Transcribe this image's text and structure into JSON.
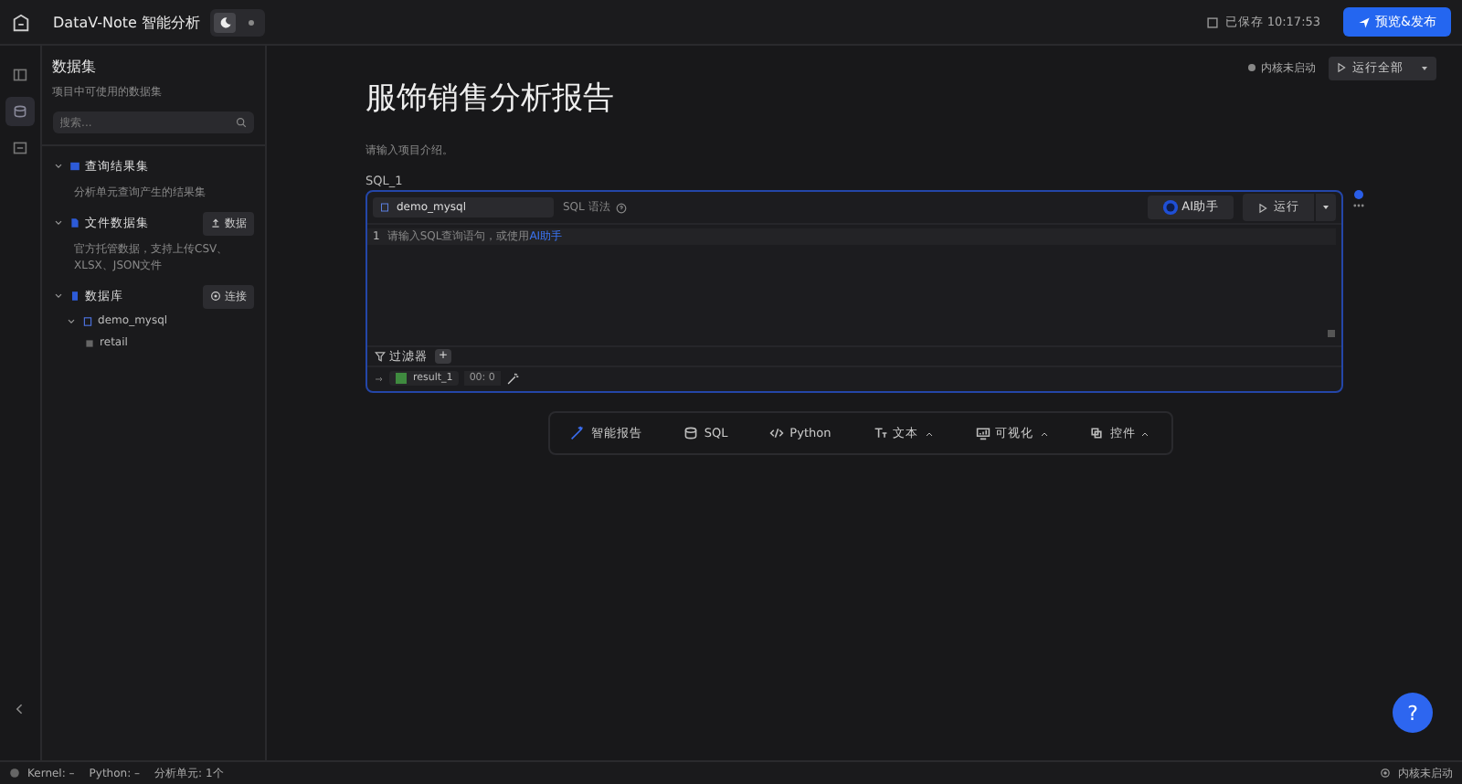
{
  "header": {
    "app_title": "DataV-Note 智能分析",
    "theme_modes": [
      {
        "kind": "dark",
        "selected": true
      },
      {
        "kind": "light",
        "selected": false
      }
    ],
    "saved": "已保存 10:17:53",
    "publish": "预览&发布"
  },
  "rail": [
    {
      "kind": "layout",
      "selected": false
    },
    {
      "kind": "database",
      "selected": true
    },
    {
      "kind": "code",
      "selected": false
    }
  ],
  "sidebar": {
    "title": "数据集",
    "subtitle": "项目中可使用的数据集",
    "search": {
      "placeholder": "搜索..."
    },
    "sections": [
      {
        "kind": "result",
        "label": "查询结果集",
        "expanded": true,
        "description": "分析单元查询产生的结果集"
      },
      {
        "kind": "file",
        "label": "文件数据集",
        "expanded": true,
        "action": "数据",
        "description": "官方托管数据，支持上传CSV、XLSX、JSON文件"
      },
      {
        "kind": "database",
        "label": "数据库",
        "expanded": true,
        "action": "连接",
        "children": [
          {
            "label": "demo_mysql",
            "expanded": true,
            "children": [
              {
                "label": "retail"
              }
            ]
          }
        ]
      }
    ]
  },
  "main": {
    "kernel_status": "内核未启动",
    "run_all": "运行全部",
    "title": "服饰销售分析报告",
    "description": {
      "placeholder": "请输入项目介绍。"
    },
    "cell": {
      "name": "SQL_1",
      "datasource": "demo_mysql",
      "syntax": "SQL 语法",
      "ai_button": "AI助手",
      "run_button": "运行",
      "line_number": "1",
      "editor_placeholder": "请输入SQL查询语句，或使用",
      "ai_link": "AI助手",
      "filter": "过滤器",
      "filter_add": "+",
      "result": "result_1",
      "count": "00: 0"
    },
    "add_bar": [
      {
        "kind": "ai",
        "label": "智能报告",
        "has_menu": false
      },
      {
        "kind": "sql",
        "label": "SQL",
        "has_menu": false
      },
      {
        "kind": "python",
        "label": "Python",
        "has_menu": false
      },
      {
        "kind": "text",
        "label": "文本",
        "has_menu": true
      },
      {
        "kind": "chart",
        "label": "可视化",
        "has_menu": true
      },
      {
        "kind": "widget",
        "label": "控件",
        "has_menu": true
      }
    ]
  },
  "help_button": "?",
  "status_bar": {
    "kernel": "Kernel: –",
    "python": "Python: –",
    "cells": "分析单元: 1个",
    "right": "内核未启动"
  }
}
